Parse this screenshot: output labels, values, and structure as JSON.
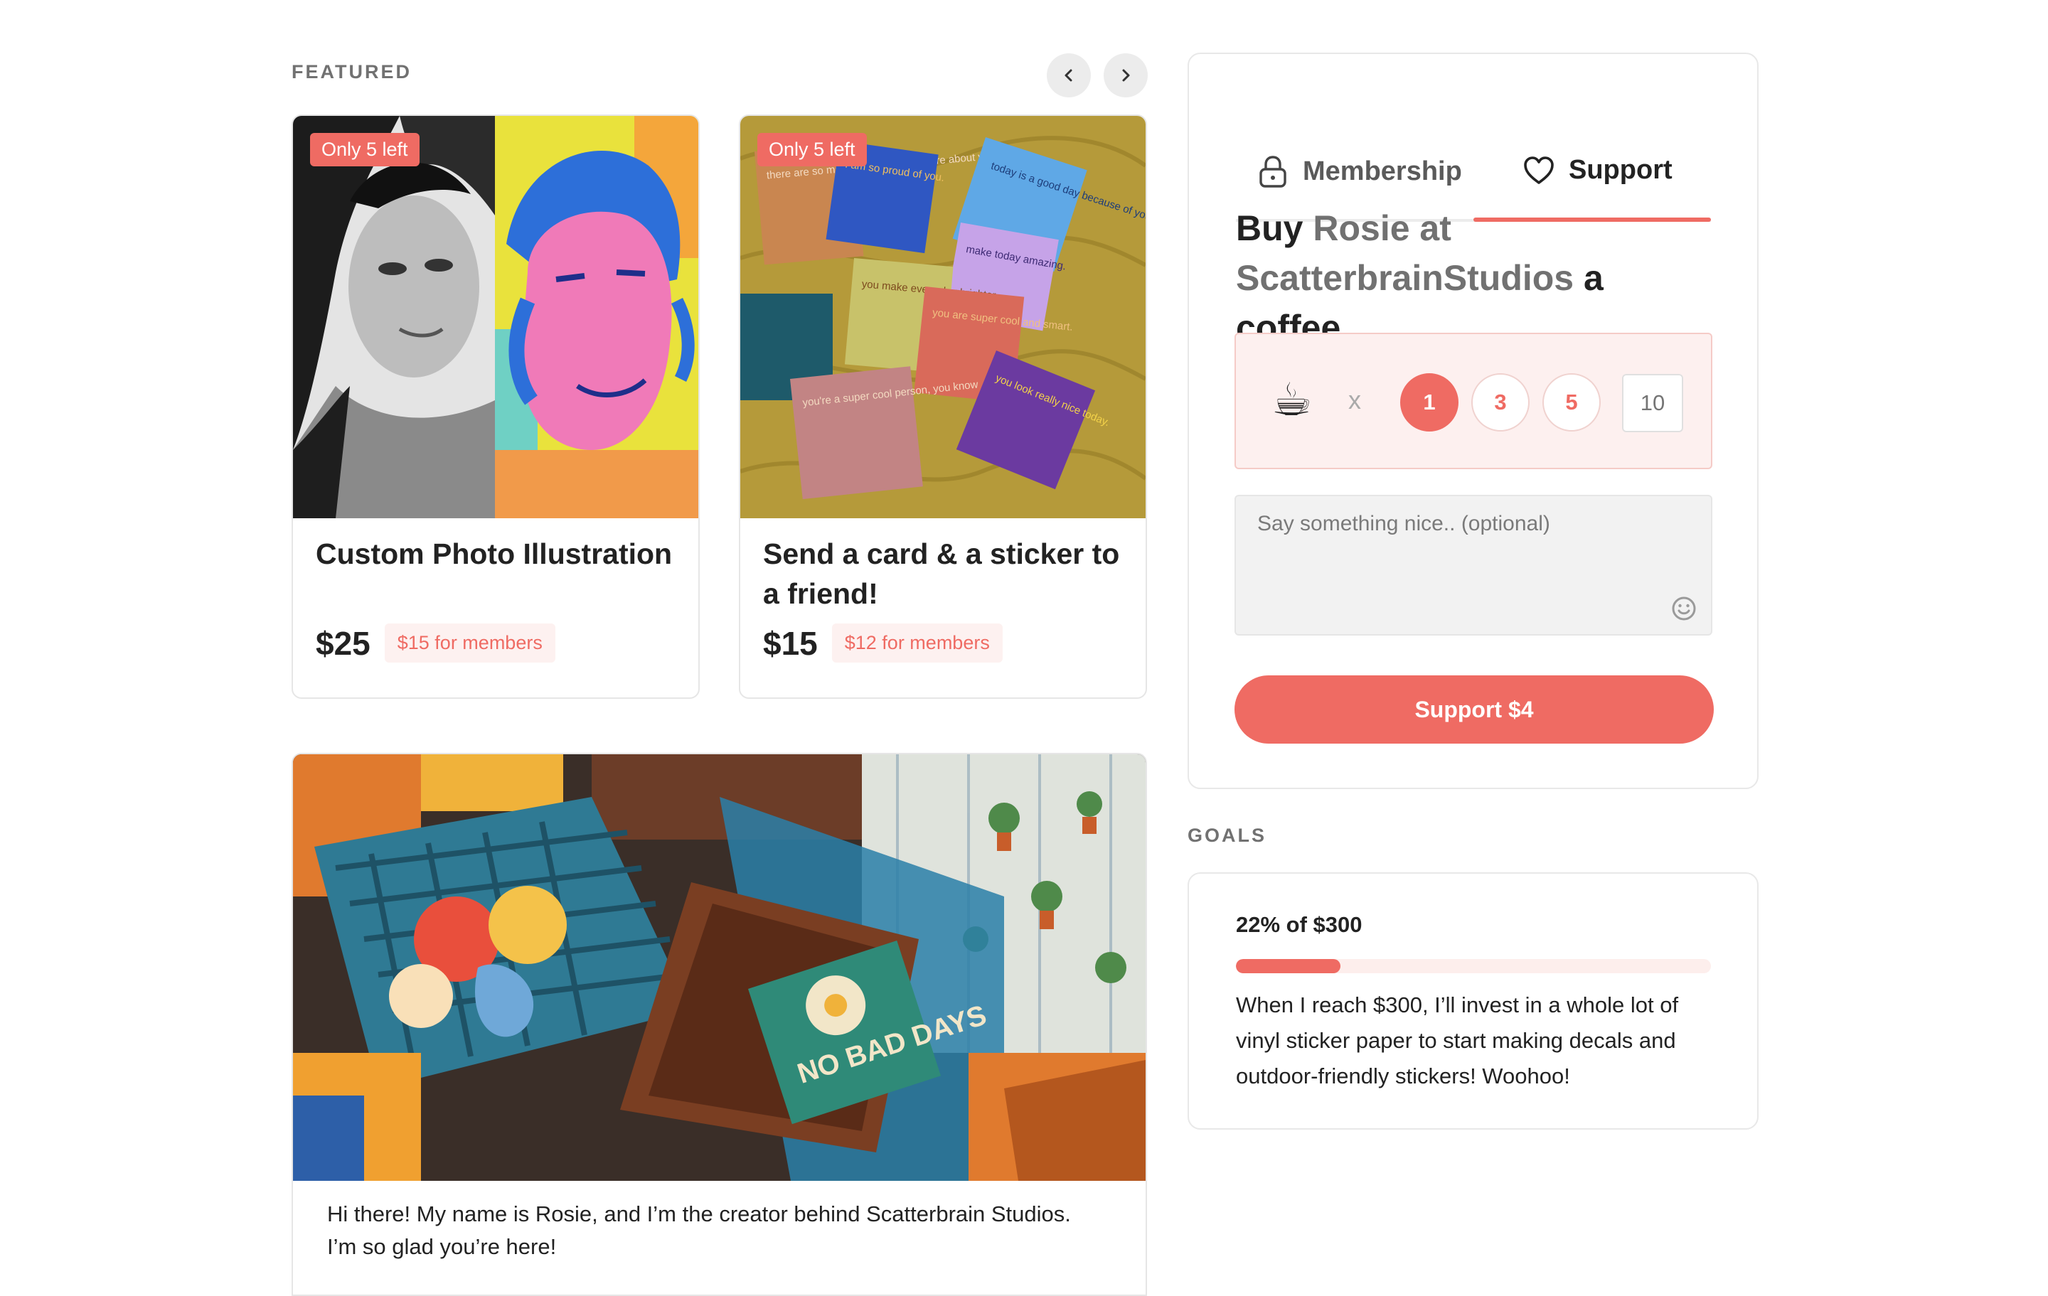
{
  "featured": {
    "label": "FEATURED",
    "items": [
      {
        "badge": "Only 5 left",
        "title": "Custom Photo Illustration",
        "price": "$25",
        "member_price": "$15 for members"
      },
      {
        "badge": "Only 5 left",
        "title": "Send a card & a sticker to a friend!",
        "price": "$15",
        "member_price": "$12 for members"
      }
    ],
    "card_texts": [
      "there are so many things that I admire about you.",
      "I am so proud of you.",
      "today is a good day because of you",
      "make today amazing.",
      "you make every day brighter.",
      "you are super cool and smart.",
      "you look really nice today.",
      "you're a super cool person, you know"
    ]
  },
  "post": {
    "intro": "Hi there! My name is Rosie, and I’m the creator behind Scatterbrain Studios.",
    "intro_cont": "I’m so glad you’re here!",
    "sign_text": "NO BAD DAYS"
  },
  "support": {
    "tabs": [
      {
        "label": "Membership",
        "icon": "lock-icon"
      },
      {
        "label": "Support",
        "icon": "heart-icon",
        "active": true
      }
    ],
    "heading": {
      "pre": "Buy",
      "name": "Rosie at ScatterbrainStudios",
      "post": "a coffee"
    },
    "coffee_emoji": "☕",
    "times": "x",
    "quantities": [
      "1",
      "3",
      "5"
    ],
    "selected_quantity": "1",
    "custom_quantity_placeholder": "10",
    "message_placeholder": "Say something nice.. (optional)",
    "button_label": "Support $4"
  },
  "goals": {
    "label": "GOALS",
    "progress_text": "22% of $300",
    "progress_percent": 22,
    "description": "When I reach $300, I’ll invest in a whole lot of vinyl sticker paper to start making decals and outdoor-friendly stickers! Woohoo!"
  },
  "colors": {
    "accent": "#ef6b63",
    "accent_light": "#fdeeec",
    "text": "#222222",
    "muted": "#717171"
  }
}
